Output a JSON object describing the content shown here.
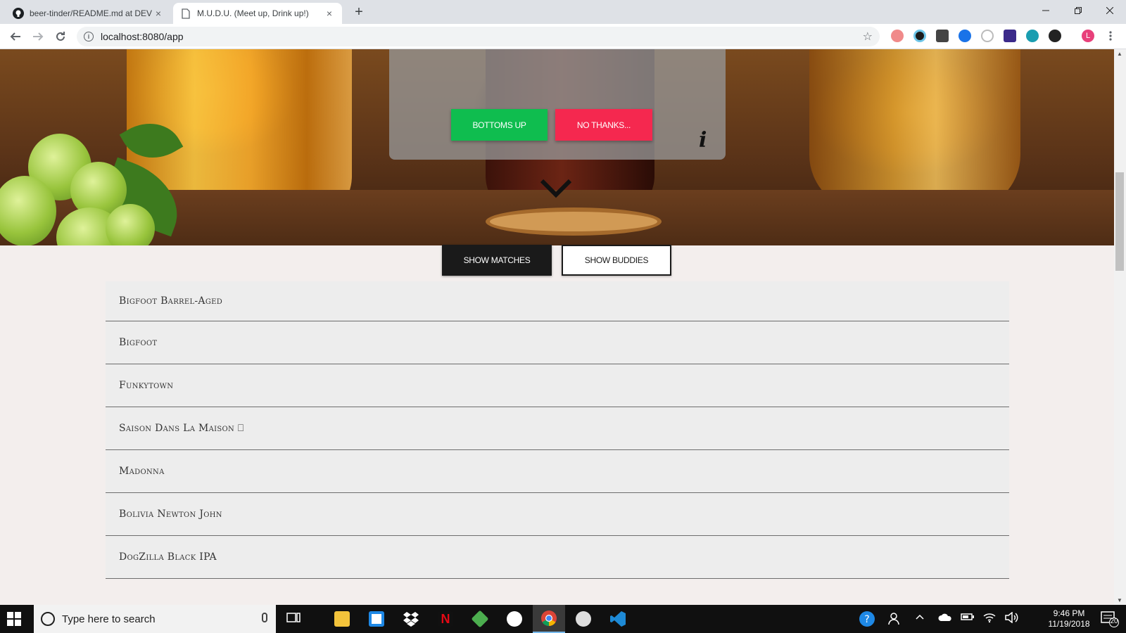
{
  "browser": {
    "tabs": [
      {
        "title": "beer-tinder/README.md at DEV",
        "active": false
      },
      {
        "title": "M.U.D.U. (Meet up, Drink up!)",
        "active": true
      }
    ],
    "url": "localhost:8080/app",
    "new_tab_glyph": "+",
    "close_glyph": "×"
  },
  "card": {
    "yes_label": "BOTTOMS UP",
    "no_label": "NO THANKS...",
    "info_glyph": "i",
    "yes_color": "#0fbd4f",
    "no_color": "#f5284f"
  },
  "toggle": {
    "matches_label": "SHOW MATCHES",
    "buddies_label": "SHOW BUDDIES"
  },
  "matches": [
    "Bigfoot Barrel-Aged",
    "Bigfoot",
    "Funkytown",
    "Saison Dans La Maison ⎕",
    "Madonna",
    "Bolivia Newton John",
    "DogZilla Black IPA"
  ],
  "taskbar": {
    "search_placeholder": "Type here to search",
    "time": "9:46 PM",
    "date": "11/19/2018",
    "notification_count": "20"
  }
}
